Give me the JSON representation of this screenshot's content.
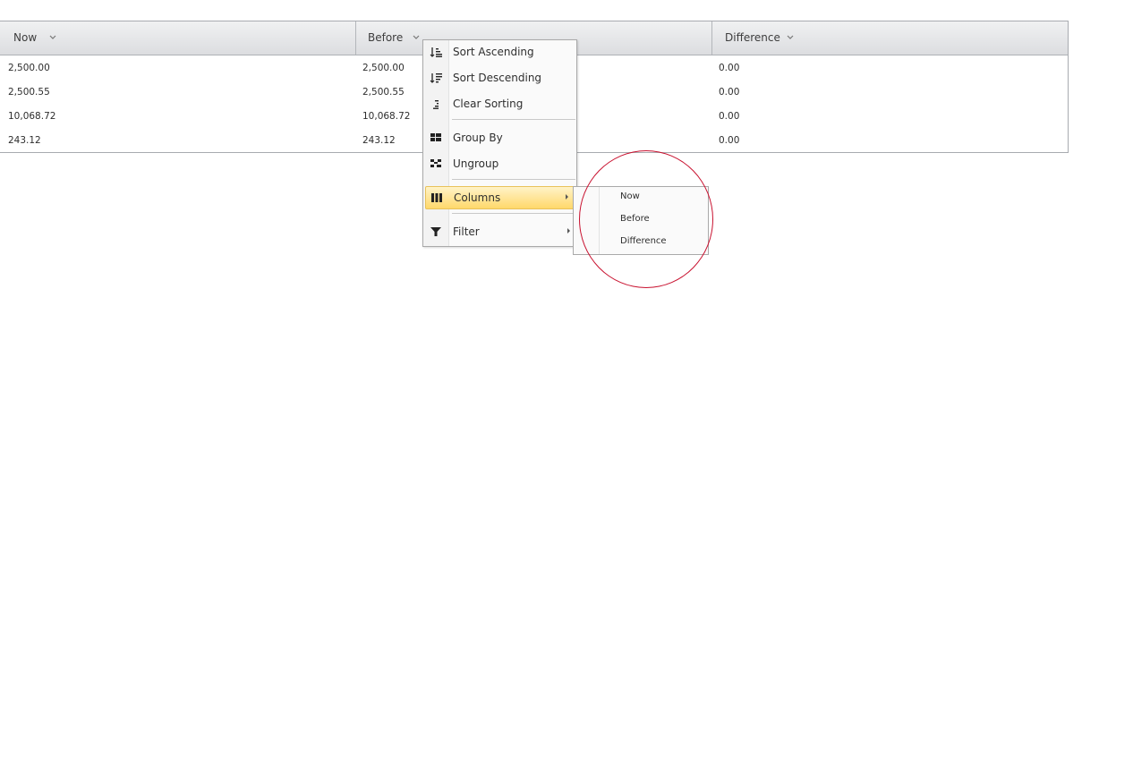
{
  "grid": {
    "columns": [
      {
        "label": "Now"
      },
      {
        "label": "Before"
      },
      {
        "label": "Difference"
      }
    ],
    "rows": [
      [
        "2,500.00",
        "2,500.00",
        "0.00"
      ],
      [
        "2,500.55",
        "2,500.55",
        "0.00"
      ],
      [
        "10,068.72",
        "10,068.72",
        "0.00"
      ],
      [
        "243.12",
        "243.12",
        "0.00"
      ]
    ]
  },
  "context_menu": {
    "items": [
      {
        "label": "Sort Ascending",
        "icon": "sort-ascending-icon"
      },
      {
        "label": "Sort Descending",
        "icon": "sort-descending-icon"
      },
      {
        "label": "Clear Sorting",
        "icon": "clear-sorting-icon"
      },
      {
        "label": "Group By",
        "icon": "group-by-icon"
      },
      {
        "label": "Ungroup",
        "icon": "ungroup-icon"
      },
      {
        "label": "Columns",
        "icon": "columns-icon",
        "highlighted": true,
        "has_submenu": true
      },
      {
        "label": "Filter",
        "icon": "filter-icon",
        "has_submenu": true
      }
    ]
  },
  "columns_submenu": {
    "items": [
      {
        "label": "Now"
      },
      {
        "label": "Before"
      },
      {
        "label": "Difference"
      }
    ]
  },
  "colors": {
    "highlight_circle": "#c8102e",
    "menu_highlight": "#ffd86b"
  }
}
